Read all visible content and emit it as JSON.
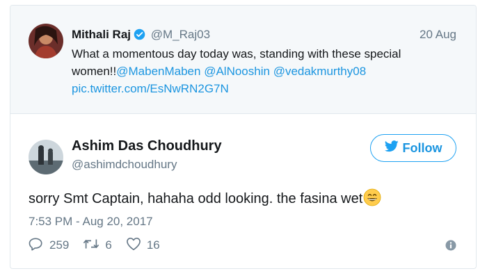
{
  "quoted_tweet": {
    "author_name": "Mithali Raj",
    "author_handle": "@M_Raj03",
    "date": "20 Aug",
    "text_plain": "What a momentous day today was, standing with these special women!!",
    "mentions": [
      "@MabenMaben",
      "@AlNooshin",
      "@vedakmurthy08"
    ],
    "pic_link": "pic.twitter.com/EsNwRN2G7N"
  },
  "tweet": {
    "author_name": "Ashim Das Choudhury",
    "author_handle": "@ashimdchoudhury",
    "follow_label": "Follow",
    "text": "sorry Smt Captain, hahaha odd looking. the fasina wet",
    "timestamp": "7:53 PM - Aug 20, 2017",
    "replies": "259",
    "retweets": "6",
    "likes": "16"
  },
  "colors": {
    "link": "#1b95e0",
    "muted": "#657786",
    "border": "#e1e8ed",
    "quoted_bg": "#f5f8fa"
  },
  "icons": [
    "verified-badge-icon",
    "twitter-bird-icon",
    "grinning-emoji-icon",
    "reply-icon",
    "retweet-icon",
    "heart-icon",
    "info-icon"
  ]
}
